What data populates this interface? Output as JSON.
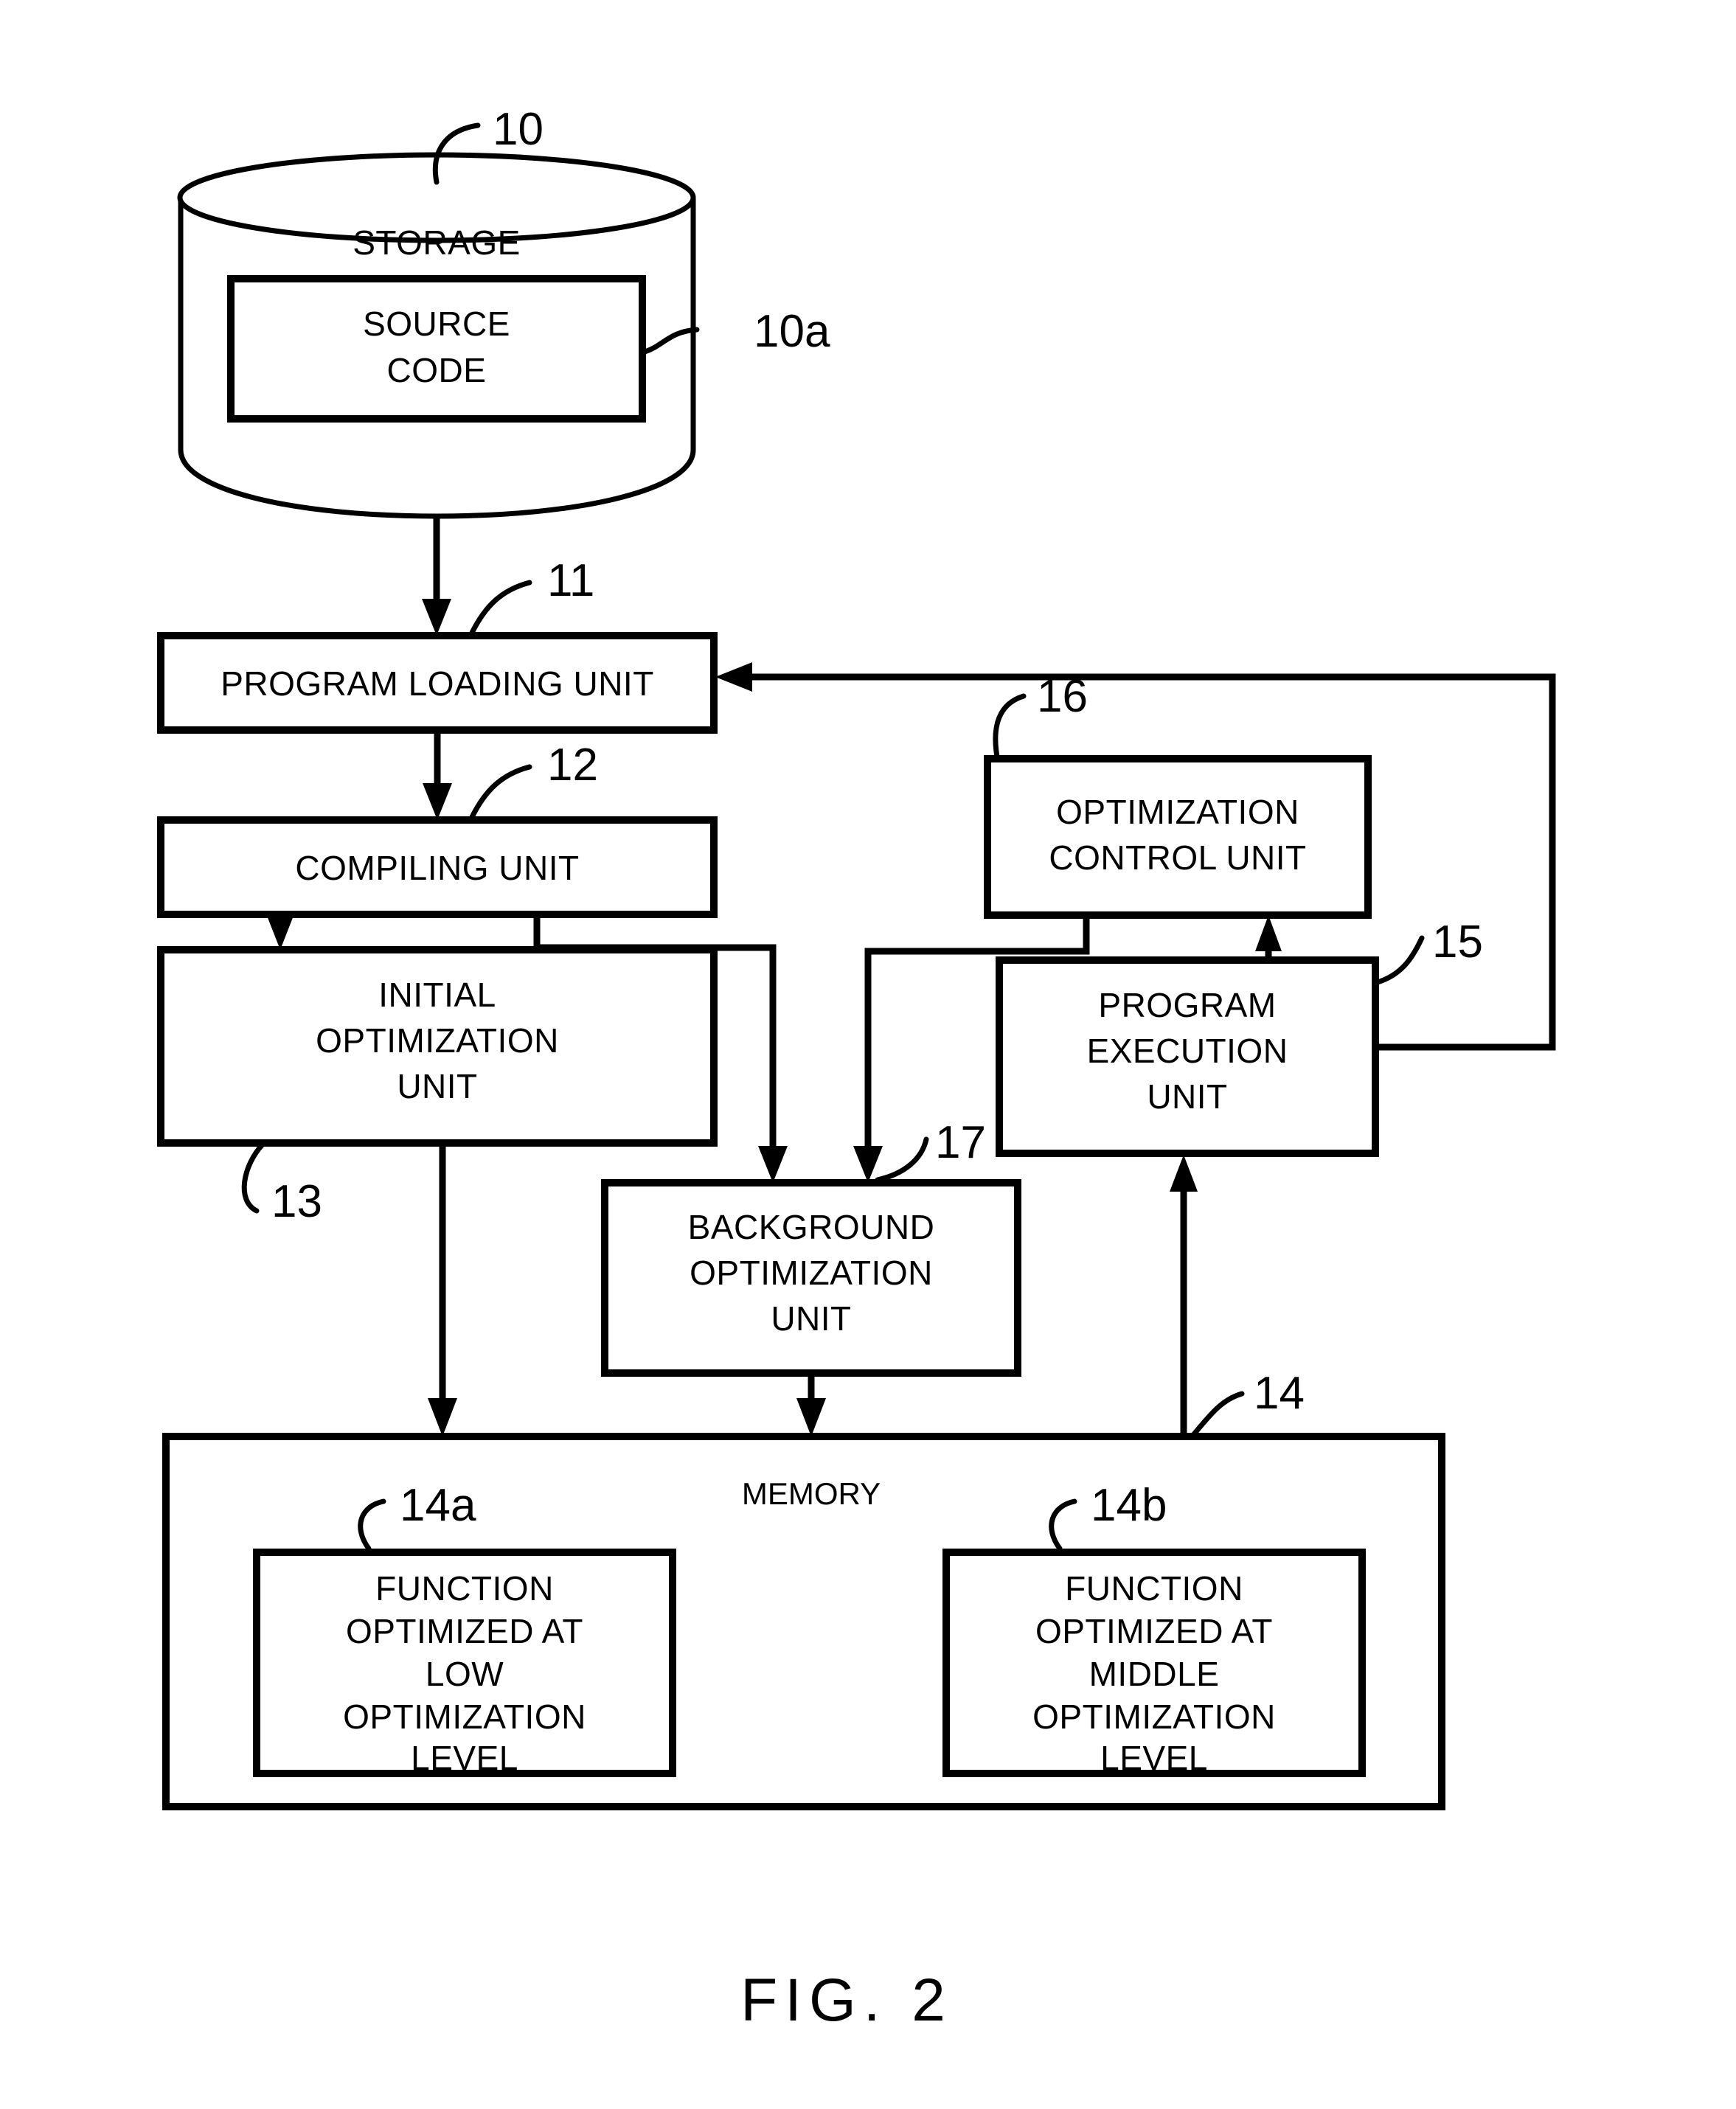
{
  "figure": {
    "caption": "FIG.  2",
    "title": "FIG. 2"
  },
  "nodes": {
    "storage": {
      "label": "STORAGE",
      "ref": "10"
    },
    "source_code": {
      "line1": "SOURCE",
      "line2": "CODE",
      "ref": "10a"
    },
    "program_loading_unit": {
      "label": "PROGRAM LOADING UNIT",
      "ref": "11"
    },
    "compiling_unit": {
      "label": "COMPILING UNIT",
      "ref": "12"
    },
    "initial_optimization_unit": {
      "line1": "INITIAL",
      "line2": "OPTIMIZATION",
      "line3": "UNIT",
      "ref": "13"
    },
    "optimization_control_unit": {
      "line1": "OPTIMIZATION",
      "line2": "CONTROL UNIT",
      "ref": "16"
    },
    "program_execution_unit": {
      "line1": "PROGRAM",
      "line2": "EXECUTION",
      "line3": "UNIT",
      "ref": "15"
    },
    "background_optimization_unit": {
      "line1": "BACKGROUND",
      "line2": "OPTIMIZATION",
      "line3": "UNIT",
      "ref": "17"
    },
    "memory": {
      "label": "MEMORY",
      "ref": "14"
    },
    "function_low": {
      "line1": "FUNCTION",
      "line2": "OPTIMIZED AT",
      "line3": "LOW",
      "line4": "OPTIMIZATION",
      "line5": "LEVEL",
      "ref": "14a"
    },
    "function_middle": {
      "line1": "FUNCTION",
      "line2": "OPTIMIZED AT",
      "line3": "MIDDLE",
      "line4": "OPTIMIZATION",
      "line5": "LEVEL",
      "ref": "14b"
    }
  },
  "colors": {
    "ink": "#000000",
    "paper": "#ffffff"
  }
}
